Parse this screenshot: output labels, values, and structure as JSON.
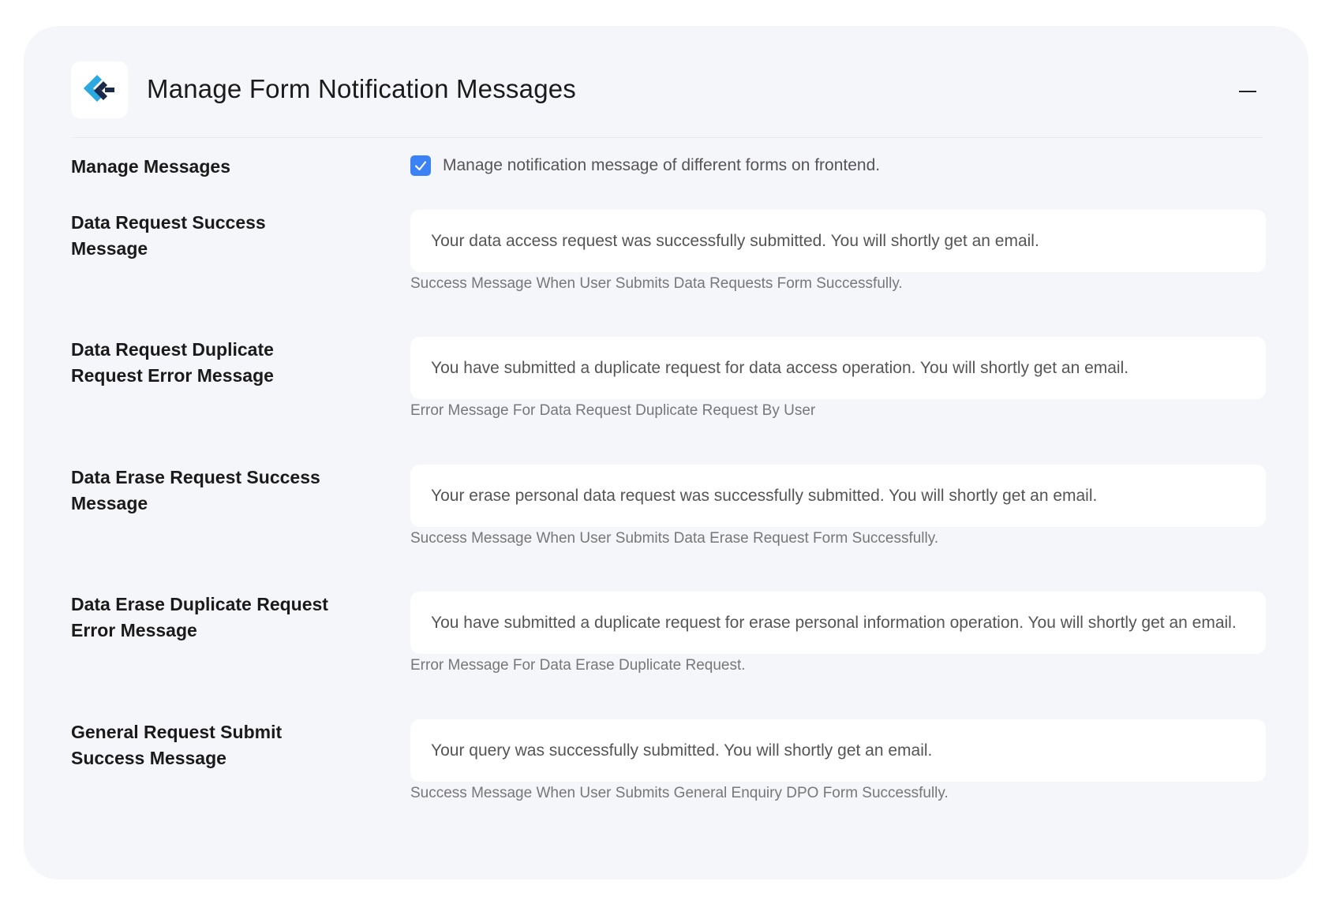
{
  "header": {
    "title": "Manage Form Notification Messages",
    "logo_icon": "brand-logo-icon",
    "collapse_icon": "minus-icon"
  },
  "colors": {
    "accent": "#3b82f6",
    "logo_dark": "#1b2a4a",
    "logo_blue": "#2aa8e0"
  },
  "manage_messages": {
    "label": "Manage Messages",
    "checked": true,
    "checkbox_text": "Manage notification message of different forms on frontend."
  },
  "fields": [
    {
      "label_line1": "Data Request Success",
      "label_line2": "Message",
      "value": "Your data access request was successfully submitted. You will shortly get an email.",
      "help": "Success Message When User Submits Data Requests Form Successfully."
    },
    {
      "label_line1": "Data Request Duplicate",
      "label_line2": "Request Error Message",
      "value": "You have submitted a duplicate request for data access operation. You will shortly get an email.",
      "help": "Error Message For Data Request Duplicate Request By User"
    },
    {
      "label_line1": "Data Erase Request Success",
      "label_line2": "Message",
      "value": "Your erase personal data request was successfully submitted. You will shortly get an email.",
      "help": "Success Message When User Submits Data Erase Request Form Successfully."
    },
    {
      "label_line1": "Data Erase Duplicate Request",
      "label_line2": "Error Message",
      "value": "You have submitted a duplicate request for erase personal information operation. You will shortly get an email.",
      "help": "Error Message For Data Erase Duplicate Request."
    },
    {
      "label_line1": "General Request Submit",
      "label_line2": "Success Message",
      "value": "Your query was successfully submitted. You will shortly get an email.",
      "help": "Success Message When User Submits General Enquiry DPO Form Successfully."
    }
  ]
}
